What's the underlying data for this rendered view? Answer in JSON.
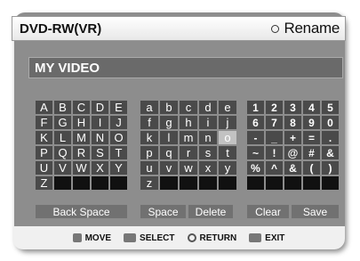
{
  "header": {
    "title": "DVD-RW(VR)",
    "rename_label": "Rename"
  },
  "name_field": {
    "value": "MY VIDEO"
  },
  "upper_keys": [
    "A",
    "B",
    "C",
    "D",
    "E",
    "F",
    "G",
    "H",
    "I",
    "J",
    "K",
    "L",
    "M",
    "N",
    "O",
    "P",
    "Q",
    "R",
    "S",
    "T",
    "U",
    "V",
    "W",
    "X",
    "Y",
    "Z",
    "",
    "",
    "",
    ""
  ],
  "lower_keys": [
    "a",
    "b",
    "c",
    "d",
    "e",
    "f",
    "g",
    "h",
    "i",
    "j",
    "k",
    "l",
    "m",
    "n",
    "o",
    "p",
    "q",
    "r",
    "s",
    "t",
    "u",
    "v",
    "w",
    "x",
    "y",
    "z",
    "",
    "",
    "",
    ""
  ],
  "symbol_keys": [
    "1",
    "2",
    "3",
    "4",
    "5",
    "6",
    "7",
    "8",
    "9",
    "0",
    "-",
    "_",
    "+",
    "=",
    ".",
    "~",
    "!",
    "@",
    "#",
    "&",
    "%",
    "^",
    "&",
    "(",
    ")",
    "",
    "",
    "",
    "",
    ""
  ],
  "selected_key": "o",
  "buttons": {
    "back_space": "Back Space",
    "space": "Space",
    "delete": "Delete",
    "clear": "Clear",
    "save": "Save"
  },
  "footer": {
    "move": "MOVE",
    "select": "SELECT",
    "return": "RETURN",
    "exit": "EXIT"
  }
}
